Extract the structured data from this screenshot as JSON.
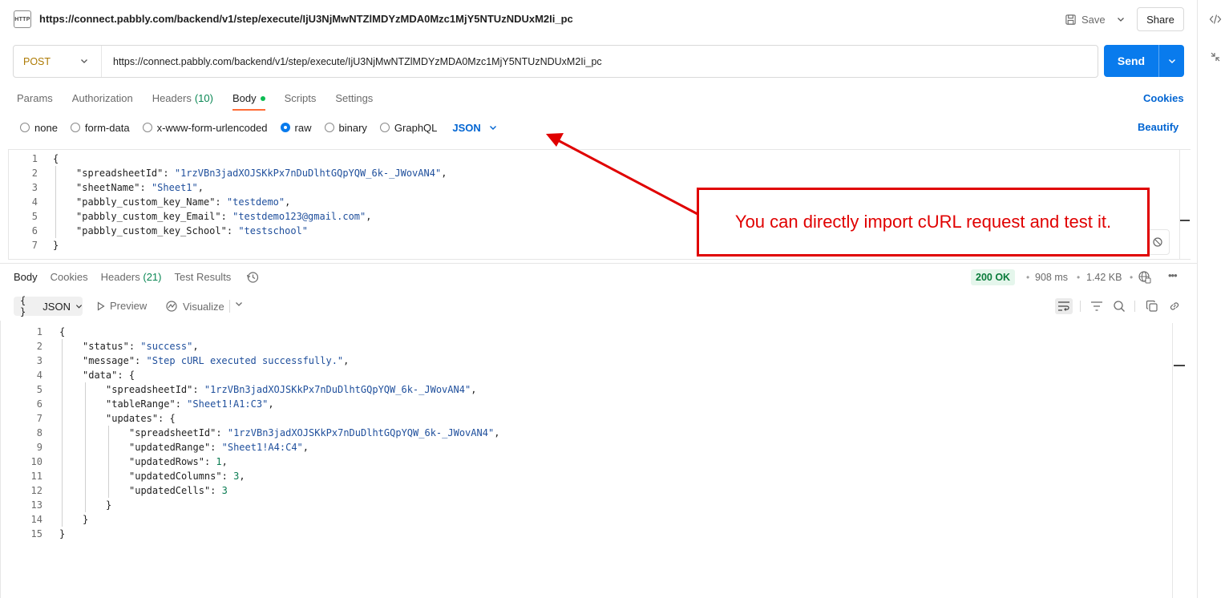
{
  "header": {
    "http_icon": "HTTP",
    "title": "https://connect.pabbly.com/backend/v1/step/execute/IjU3NjMwNTZlMDYzMDA0Mzc1MjY5NTUzNDUxM2Ii_pc",
    "save_label": "Save",
    "share_label": "Share"
  },
  "right_rail": {
    "icons": [
      "code-icon",
      "collapse-icon"
    ]
  },
  "request": {
    "method": "POST",
    "url": "https://connect.pabbly.com/backend/v1/step/execute/IjU3NjMwNTZlMDYzMDA0Mzc1MjY5NTUzNDUxM2Ii_pc",
    "send_label": "Send",
    "tabs": [
      {
        "label": "Params"
      },
      {
        "label": "Authorization"
      },
      {
        "label": "Headers",
        "count": "(10)"
      },
      {
        "label": "Body",
        "active": true
      },
      {
        "label": "Scripts"
      },
      {
        "label": "Settings"
      }
    ],
    "cookies_label": "Cookies",
    "body_types": [
      "none",
      "form-data",
      "x-www-form-urlencoded",
      "raw",
      "binary",
      "GraphQL"
    ],
    "selected_body_type": "raw",
    "format": "JSON",
    "beautify_label": "Beautify",
    "body_lines": [
      {
        "n": "1",
        "text": "{"
      },
      {
        "n": "2",
        "key": "spreadsheetId",
        "value": "\"1rzVBn3jadXOJSKkPx7nDuDlhtGQpYQW_6k-_JWovAN4\"",
        "tail": ","
      },
      {
        "n": "3",
        "key": "sheetName",
        "value": "\"Sheet1\"",
        "tail": ","
      },
      {
        "n": "4",
        "key": "pabbly_custom_key_Name",
        "value": "\"testdemo\"",
        "tail": ","
      },
      {
        "n": "5",
        "key": "pabbly_custom_key_Email",
        "value": "\"testdemo123@gmail.com\"",
        "tail": ","
      },
      {
        "n": "6",
        "key": "pabbly_custom_key_School",
        "value": "\"testschool\"",
        "tail": ""
      },
      {
        "n": "7",
        "text": "}"
      }
    ]
  },
  "annotation": {
    "text": "You can directly import cURL request and test it.",
    "color": "#e00000"
  },
  "response": {
    "tabs": [
      {
        "label": "Body",
        "active": true
      },
      {
        "label": "Cookies"
      },
      {
        "label": "Headers",
        "count": "(21)"
      },
      {
        "label": "Test Results"
      }
    ],
    "status": "200 OK",
    "time": "908 ms",
    "size": "1.42 KB",
    "format": "JSON",
    "braces": "{ }",
    "preview_label": "Preview",
    "visualize_label": "Visualize",
    "lines": [
      {
        "n": "1",
        "indent": 0,
        "text": "{"
      },
      {
        "n": "2",
        "indent": 1,
        "key": "status",
        "value": "\"success\"",
        "tail": ","
      },
      {
        "n": "3",
        "indent": 1,
        "key": "message",
        "value": "\"Step cURL executed successfully.\"",
        "tail": ","
      },
      {
        "n": "4",
        "indent": 1,
        "key": "data",
        "text_after": "{"
      },
      {
        "n": "5",
        "indent": 2,
        "key": "spreadsheetId",
        "value": "\"1rzVBn3jadXOJSKkPx7nDuDlhtGQpYQW_6k-_JWovAN4\"",
        "tail": ","
      },
      {
        "n": "6",
        "indent": 2,
        "key": "tableRange",
        "value": "\"Sheet1!A1:C3\"",
        "tail": ","
      },
      {
        "n": "7",
        "indent": 2,
        "key": "updates",
        "text_after": "{"
      },
      {
        "n": "8",
        "indent": 3,
        "key": "spreadsheetId",
        "value": "\"1rzVBn3jadXOJSKkPx7nDuDlhtGQpYQW_6k-_JWovAN4\"",
        "tail": ","
      },
      {
        "n": "9",
        "indent": 3,
        "key": "updatedRange",
        "value": "\"Sheet1!A4:C4\"",
        "tail": ","
      },
      {
        "n": "10",
        "indent": 3,
        "key": "updatedRows",
        "num": "1",
        "tail": ","
      },
      {
        "n": "11",
        "indent": 3,
        "key": "updatedColumns",
        "num": "3",
        "tail": ","
      },
      {
        "n": "12",
        "indent": 3,
        "key": "updatedCells",
        "num": "3",
        "tail": ""
      },
      {
        "n": "13",
        "indent": 2,
        "text": "}"
      },
      {
        "n": "14",
        "indent": 1,
        "text": "}"
      },
      {
        "n": "15",
        "indent": 0,
        "text": "}"
      }
    ]
  },
  "colors": {
    "accent": "#097bed",
    "link": "#0265d2",
    "method": "#ad7a03",
    "status_ok_bg": "#e5f6ec",
    "status_ok_fg": "#0a7c3b"
  }
}
